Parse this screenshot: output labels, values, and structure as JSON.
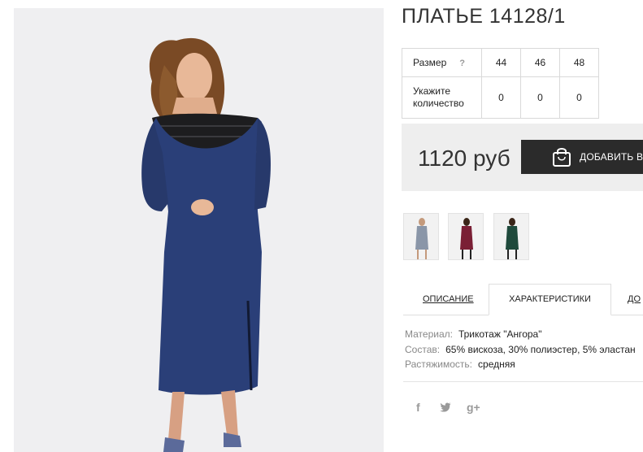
{
  "product": {
    "title": "ПЛАТЬЕ 14128/1",
    "main_image": "model-in-blue-knit-dress-with-black-lace-yoke"
  },
  "sizes": {
    "label": "Размер",
    "help": "?",
    "values": [
      "44",
      "46",
      "48"
    ],
    "quantity_label_line1": "Укажите",
    "quantity_label_line2": "количество",
    "quantities": [
      "0",
      "0",
      "0"
    ]
  },
  "price": {
    "amount": "1120 руб",
    "add_to_cart": "ДОБАВИТЬ В З"
  },
  "thumbnails": [
    {
      "color": "#8a96a8",
      "name": "grey"
    },
    {
      "color": "#7a1f35",
      "name": "burgundy"
    },
    {
      "color": "#1f4a3c",
      "name": "green"
    }
  ],
  "tabs": {
    "description": "ОПИСАНИЕ",
    "characteristics": "ХАРАКТЕРИСТИКИ",
    "third": "ДО"
  },
  "specs": [
    {
      "key": "Материал:",
      "value": "Трикотаж \"Ангора\""
    },
    {
      "key": "Состав:",
      "value": "65% вискоза, 30% полиэстер, 5% эластан"
    },
    {
      "key": "Растяжимость:",
      "value": "средняя"
    }
  ],
  "social": {
    "facebook": "f",
    "twitter": "twitter",
    "googleplus": "g+"
  },
  "colors": {
    "dress_blue": "#2a3f78",
    "lace_black": "#1a1a1a",
    "button_dark": "#2b2b2b",
    "price_bg": "#eeeeee"
  }
}
